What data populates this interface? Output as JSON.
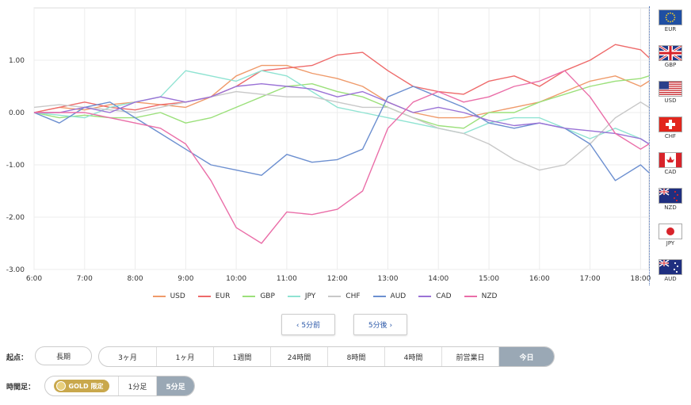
{
  "chart_data": {
    "type": "line",
    "x_ticks": [
      "6:00",
      "7:00",
      "8:00",
      "9:00",
      "10:00",
      "11:00",
      "12:00",
      "13:00",
      "14:00",
      "15:00",
      "16:00",
      "17:00",
      "18:00"
    ],
    "y_ticks": [
      "1.00",
      "0.00",
      "-1.00",
      "-2.00",
      "-3.00"
    ],
    "xlim": [
      "6:00",
      "18:10"
    ],
    "ylim": [
      -3.0,
      2.0
    ],
    "grid": true,
    "legend_position": "bottom",
    "x": [
      "6:00",
      "6:30",
      "7:00",
      "7:30",
      "8:00",
      "8:30",
      "9:00",
      "9:30",
      "10:00",
      "10:30",
      "11:00",
      "11:30",
      "12:00",
      "12:30",
      "13:00",
      "13:30",
      "14:00",
      "14:30",
      "15:00",
      "15:30",
      "16:00",
      "16:30",
      "17:00",
      "17:30",
      "18:00",
      "18:10"
    ],
    "series": [
      {
        "name": "USD",
        "color": "#ef9a6a",
        "values": [
          0.0,
          0.1,
          0.05,
          0.15,
          0.2,
          0.15,
          0.1,
          0.3,
          0.7,
          0.9,
          0.9,
          0.75,
          0.65,
          0.5,
          0.2,
          0.0,
          -0.1,
          -0.1,
          0.0,
          0.1,
          0.2,
          0.4,
          0.6,
          0.7,
          0.5,
          0.6
        ]
      },
      {
        "name": "EUR",
        "color": "#ee6a6a",
        "values": [
          0.0,
          0.1,
          0.2,
          0.1,
          0.05,
          0.15,
          0.2,
          0.3,
          0.5,
          0.8,
          0.85,
          0.9,
          1.1,
          1.15,
          0.8,
          0.5,
          0.4,
          0.35,
          0.6,
          0.7,
          0.5,
          0.8,
          1.0,
          1.3,
          1.2,
          1.05
        ]
      },
      {
        "name": "GBP",
        "color": "#9be07a",
        "values": [
          0.0,
          -0.1,
          -0.05,
          -0.1,
          -0.1,
          0.0,
          -0.2,
          -0.1,
          0.1,
          0.3,
          0.5,
          0.55,
          0.4,
          0.3,
          0.1,
          -0.1,
          -0.25,
          -0.3,
          0.0,
          0.0,
          0.2,
          0.35,
          0.5,
          0.6,
          0.65,
          0.7
        ]
      },
      {
        "name": "JPY",
        "color": "#8fe3d2",
        "values": [
          0.0,
          -0.05,
          -0.1,
          0.1,
          0.2,
          0.3,
          0.8,
          0.7,
          0.6,
          0.8,
          0.7,
          0.4,
          0.1,
          0.0,
          -0.1,
          -0.2,
          -0.3,
          -0.4,
          -0.2,
          -0.1,
          -0.1,
          -0.3,
          -0.5,
          -0.3,
          -0.5,
          -0.6
        ]
      },
      {
        "name": "CHF",
        "color": "#c8c8c8",
        "values": [
          0.1,
          0.15,
          0.1,
          0.05,
          0.0,
          0.1,
          0.2,
          0.3,
          0.4,
          0.35,
          0.3,
          0.3,
          0.2,
          0.1,
          0.1,
          -0.1,
          -0.3,
          -0.4,
          -0.6,
          -0.9,
          -1.1,
          -1.0,
          -0.6,
          -0.1,
          0.2,
          0.1
        ]
      },
      {
        "name": "AUD",
        "color": "#6c8fd0",
        "values": [
          0.0,
          -0.2,
          0.1,
          0.2,
          -0.1,
          -0.4,
          -0.7,
          -1.0,
          -1.1,
          -1.2,
          -0.8,
          -0.95,
          -0.9,
          -0.7,
          0.3,
          0.5,
          0.3,
          0.1,
          -0.2,
          -0.3,
          -0.2,
          -0.3,
          -0.6,
          -1.3,
          -1.0,
          -1.15
        ]
      },
      {
        "name": "CAD",
        "color": "#9a72d6",
        "values": [
          0.0,
          0.0,
          0.1,
          0.0,
          0.2,
          0.3,
          0.2,
          0.3,
          0.5,
          0.55,
          0.5,
          0.45,
          0.3,
          0.4,
          0.2,
          0.0,
          0.1,
          0.0,
          -0.15,
          -0.25,
          -0.2,
          -0.3,
          -0.35,
          -0.4,
          -0.5,
          -0.6
        ]
      },
      {
        "name": "NZD",
        "color": "#ea6ea8",
        "values": [
          0.0,
          0.0,
          0.0,
          -0.1,
          -0.2,
          -0.3,
          -0.6,
          -1.3,
          -2.2,
          -2.5,
          -1.9,
          -1.95,
          -1.85,
          -1.5,
          -0.3,
          0.2,
          0.4,
          0.2,
          0.3,
          0.5,
          0.6,
          0.8,
          0.3,
          -0.4,
          -0.7,
          -0.6
        ]
      }
    ]
  },
  "flags": [
    {
      "code": "EUR",
      "bg": "#1f4fa3",
      "icon": "eu-flag-icon"
    },
    {
      "code": "GBP",
      "bg": "#1f3a8a",
      "icon": "uk-flag-icon"
    },
    {
      "code": "USD",
      "bg": "#ffffff",
      "icon": "us-flag-icon"
    },
    {
      "code": "CHF",
      "bg": "#e2261d",
      "icon": "swiss-flag-icon"
    },
    {
      "code": "CAD",
      "bg": "#ffffff",
      "icon": "canada-flag-icon"
    },
    {
      "code": "NZD",
      "bg": "#1f2f80",
      "icon": "nz-flag-icon"
    },
    {
      "code": "JPY",
      "bg": "#ffffff",
      "icon": "japan-flag-icon"
    },
    {
      "code": "AUD",
      "bg": "#1f2f80",
      "icon": "australia-flag-icon"
    }
  ],
  "nav": {
    "prev_label": "‹ 5分前",
    "next_label": "5分後 ›"
  },
  "origin": {
    "label": "起点：",
    "first": "長期",
    "items": [
      "3ヶ月",
      "1ヶ月",
      "1週間",
      "24時間",
      "8時間",
      "4時間",
      "前営業日",
      "今日"
    ],
    "active": "今日"
  },
  "timeframe": {
    "label": "時間足：",
    "gold_text": "GOLD 限定",
    "items": [
      "1分足",
      "5分足"
    ],
    "active": "5分足"
  }
}
